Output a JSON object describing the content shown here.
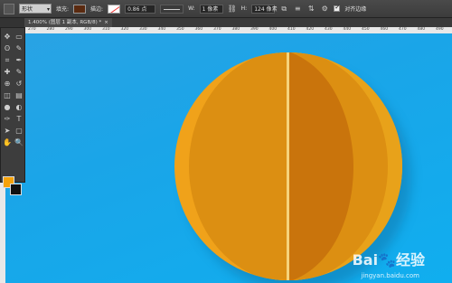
{
  "options_bar": {
    "tool_mode": "形状",
    "fill_label": "填充:",
    "fill_color": "#5a2a10",
    "stroke_label": "描边:",
    "stroke_width": "0.86 点",
    "width_label": "W:",
    "width_value": "1 像素",
    "height_label": "H:",
    "height_value": "124 像素",
    "align_edges_label": "对齐边缘"
  },
  "document": {
    "tab_title": "1.400% (图层 1 副本, RGB/8) *",
    "close_glyph": "×"
  },
  "ruler_ticks": [
    "270",
    "280",
    "290",
    "300",
    "310",
    "320",
    "330",
    "340",
    "350",
    "360",
    "370",
    "380",
    "390",
    "400",
    "410",
    "420",
    "430",
    "440",
    "450",
    "460",
    "470",
    "480",
    "490"
  ],
  "canvas": {
    "background_color": "#1aa5e8",
    "ball_colors": [
      "#f0a21a",
      "#e19213",
      "#f6b41d",
      "#d88410",
      "#c9740c"
    ]
  },
  "tools_panel": {
    "icons": [
      "move-icon",
      "marquee-icon",
      "lasso-icon",
      "quick-select-icon",
      "crop-icon",
      "eyedropper-icon",
      "healing-icon",
      "brush-icon",
      "stamp-icon",
      "history-brush-icon",
      "eraser-icon",
      "gradient-icon",
      "blur-icon",
      "dodge-icon",
      "pen-icon",
      "type-icon",
      "path-select-icon",
      "shape-icon",
      "hand-icon",
      "zoom-icon"
    ],
    "glyphs": [
      "✥",
      "▭",
      "ʘ",
      "✎",
      "⌗",
      "✒",
      "✚",
      "✎",
      "⊕",
      "↺",
      "◫",
      "▤",
      "●",
      "◐",
      "✑",
      "T",
      "➤",
      "▢",
      "✋",
      "🔍"
    ],
    "foreground_color": "#f5a20a",
    "background_color": "#111111"
  },
  "watermark": {
    "brand": "Bai",
    "suffix": "经验",
    "url": "jingyan.baidu.com"
  }
}
